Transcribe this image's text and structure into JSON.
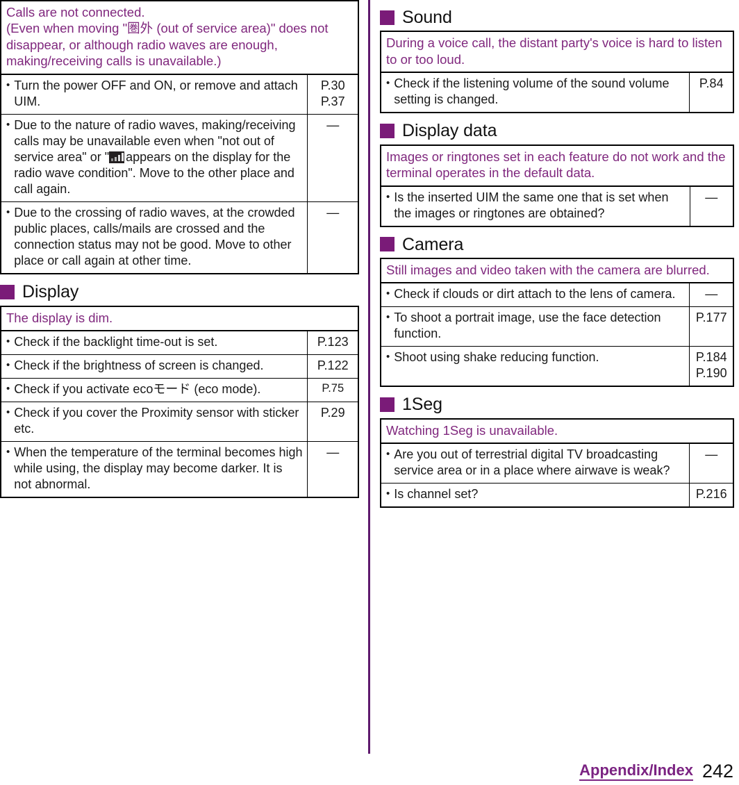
{
  "page": {
    "number": "242",
    "chapter": "Appendix/Index",
    "accent_purple": "#7a1b78",
    "heading_text_purple": "#80287e",
    "footer_purple": "#7b2382"
  },
  "left_column": {
    "tables": [
      {
        "name": "calls-not-connected",
        "header": [
          "Calls are not connected.",
          "(Even when moving \"圏外 (out of service area)\" does not disappear, or although radio waves are enough, making/receiving calls is unavailable.)"
        ],
        "rows": [
          {
            "text_before": "Turn the power OFF and ON, or remove and attach UIM.",
            "icon": null,
            "text_after": "",
            "ref": "P.30\nP.37"
          },
          {
            "text_before": "Due to the nature of radio waves, making/receiving calls may be unavailable even when \"not out of service area\" or \"",
            "icon": "signal-strength-icon",
            "text_after": "appears on the display for the radio wave condition\". Move to the other place and call again.",
            "ref": "—"
          },
          {
            "text_before": "Due to the crossing of radio waves, at the crowded public places, calls/mails are crossed and the connection status may not be good. Move to other place or call again at other time.",
            "icon": null,
            "text_after": "",
            "ref": "—"
          }
        ]
      }
    ],
    "sections": [
      {
        "name": "display",
        "title": "Display",
        "tables": [
          {
            "name": "display-is-dim",
            "header": [
              "The display is dim."
            ],
            "rows": [
              {
                "text_before": "Check if the backlight time-out is set.",
                "icon": null,
                "text_after": "",
                "ref": "P.123"
              },
              {
                "text_before": "Check if the brightness of screen is changed.",
                "icon": null,
                "text_after": "",
                "ref": "P.122"
              },
              {
                "text_before": "Check if you activate ecoモード (eco mode).",
                "icon": null,
                "text_after": "",
                "ref": "P.75",
                "ref_small": true
              },
              {
                "text_before": "Check if you cover the Proximity sensor with sticker etc.",
                "icon": null,
                "text_after": "",
                "ref": "P.29"
              },
              {
                "text_before": "When the temperature of the terminal becomes high while using, the display may become darker. It is not abnormal.",
                "icon": null,
                "text_after": "",
                "ref": "—"
              }
            ]
          }
        ]
      }
    ]
  },
  "right_column": {
    "sections": [
      {
        "name": "sound",
        "title": "Sound",
        "tables": [
          {
            "name": "distant-party-voice",
            "header": [
              "During a voice call, the distant party's voice is hard to listen to or too loud."
            ],
            "rows": [
              {
                "text_before": "Check if the listening volume of the sound volume setting is changed.",
                "icon": null,
                "text_after": "",
                "ref": "P.84"
              }
            ]
          }
        ]
      },
      {
        "name": "display-data",
        "title": "Display data",
        "tables": [
          {
            "name": "images-ringtones-default",
            "header": [
              "Images or ringtones set in each feature do not work and the terminal operates in the default data."
            ],
            "rows": [
              {
                "text_before": "Is the inserted UIM the same one that is set when the images or ringtones are obtained?",
                "icon": null,
                "text_after": "",
                "ref": "—"
              }
            ]
          }
        ]
      },
      {
        "name": "camera",
        "title": "Camera",
        "tables": [
          {
            "name": "images-blurred",
            "header": [
              "Still images and video taken with the camera are blurred."
            ],
            "rows": [
              {
                "text_before": "Check if clouds or dirt attach to the lens of camera.",
                "icon": null,
                "text_after": "",
                "ref": "—"
              },
              {
                "text_before": "To shoot a portrait image, use the face detection function.",
                "icon": null,
                "text_after": "",
                "ref": "P.177"
              },
              {
                "text_before": "Shoot using shake reducing function.",
                "icon": null,
                "text_after": "",
                "ref": "P.184\nP.190"
              }
            ]
          }
        ]
      },
      {
        "name": "1seg",
        "title": "1Seg",
        "tables": [
          {
            "name": "watching-1seg-unavailable",
            "header": [
              "Watching 1Seg is unavailable."
            ],
            "rows": [
              {
                "text_before": "Are you out of terrestrial digital TV broadcasting service area or in a place where airwave is weak?",
                "icon": null,
                "text_after": "",
                "ref": "—"
              },
              {
                "text_before": "Is channel set?",
                "icon": null,
                "text_after": "",
                "ref": "P.216"
              }
            ]
          }
        ]
      }
    ]
  }
}
